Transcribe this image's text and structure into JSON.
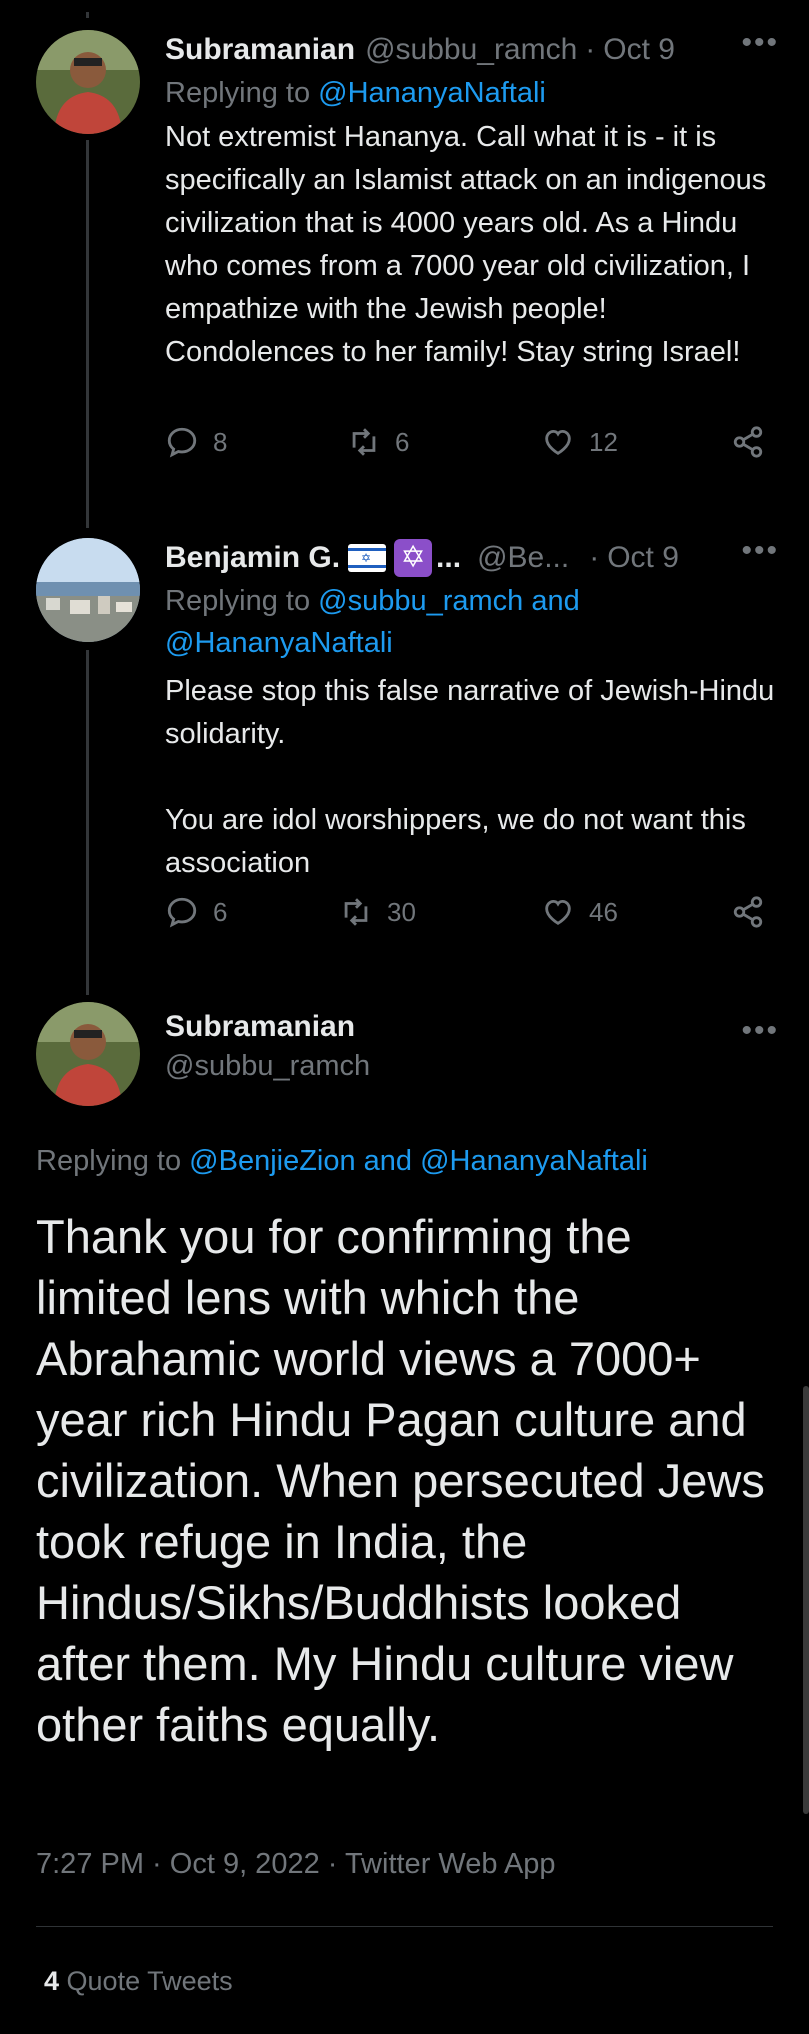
{
  "tweets": [
    {
      "name": "Subramanian",
      "handle": "@subbu_ramch",
      "sep": "·",
      "time": "Oct 9",
      "replying_prefix": "Replying to ",
      "replying_to": "@HananyaNaftali",
      "text": "Not extremist Hananya. Call what it is - it is specifically an Islamist attack on an indigenous civilization that is 4000 years old. As a Hindu who comes from a 7000 year old civilization, I empathize with the Jewish people! Condolences to her family! Stay string Israel!",
      "replies": "8",
      "retweets": "6",
      "likes": "12"
    },
    {
      "name": "Benjamin G.",
      "ellipsis": "...",
      "handle": "@Be...",
      "sep": "·",
      "time": "Oct 9",
      "replying_prefix": "Replying to ",
      "replying_to": "@subbu_ramch and @HananyaNaftali",
      "text_line1": "Please stop this false narrative of Jewish-Hindu solidarity.",
      "text_line2": "You are idol worshippers, we do not want this association",
      "replies": "6",
      "retweets": "30",
      "likes": "46"
    }
  ],
  "main": {
    "name": "Subramanian",
    "handle": "@subbu_ramch",
    "replying_prefix": "Replying to ",
    "replying_to": "@BenjieZion and @HananyaNaftali",
    "text": "Thank you for confirming the limited lens with which the Abrahamic world views a 7000+ year rich Hindu Pagan culture and civilization. When persecuted Jews took refuge in India, the Hindus/Sikhs/Buddhists looked after them. My Hindu culture view other faiths equally.",
    "meta": "7:27 PM · Oct 9, 2022 · Twitter Web App",
    "quote_count": "4",
    "quote_label": " Quote Tweets"
  },
  "icons": {
    "more": "more-icon",
    "reply": "reply-icon",
    "retweet": "retweet-icon",
    "like": "heart-icon",
    "share": "share-icon"
  },
  "colors": {
    "link": "#1d9bf0",
    "muted": "#71767b",
    "text": "#e7e9ea",
    "background": "#000000"
  }
}
